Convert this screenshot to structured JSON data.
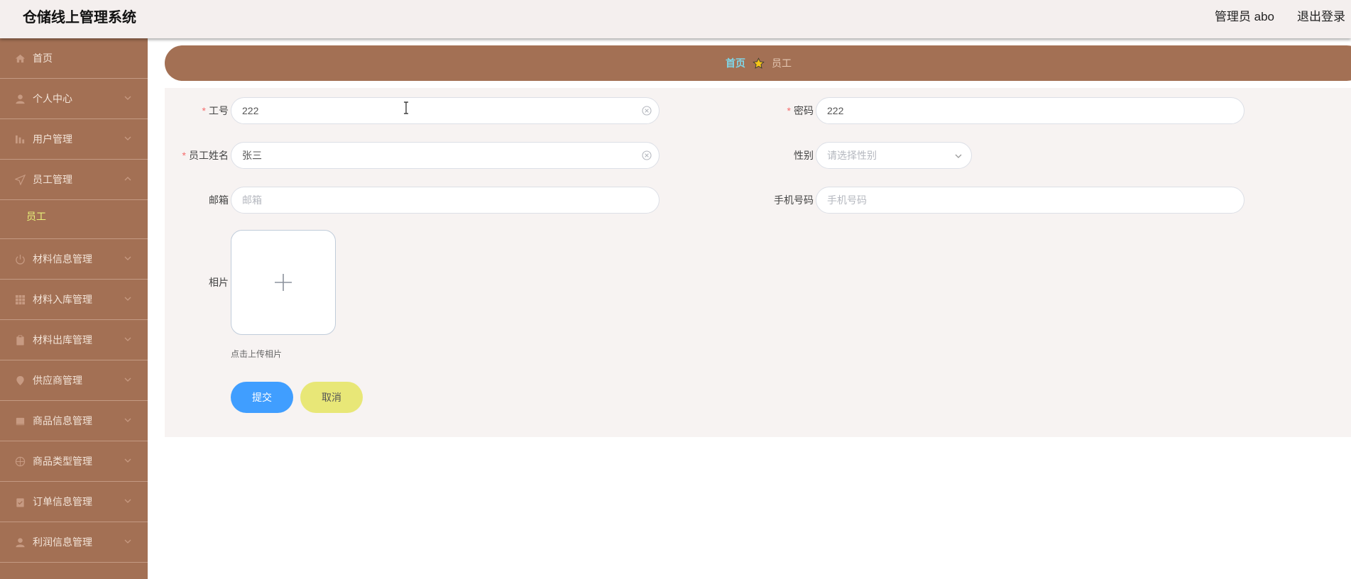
{
  "app": {
    "title": "仓储线上管理系统",
    "user": "管理员 abo",
    "logout": "退出登录"
  },
  "sidebar": {
    "items": [
      {
        "label": "首页",
        "icon": "home-icon",
        "has_arrow": false
      },
      {
        "label": "个人中心",
        "icon": "user-icon",
        "has_arrow": true
      },
      {
        "label": "用户管理",
        "icon": "chart-icon",
        "has_arrow": true
      },
      {
        "label": "员工管理",
        "icon": "paper-plane-icon",
        "has_arrow": true,
        "expanded": true
      },
      {
        "label": "材料信息管理",
        "icon": "power-icon",
        "has_arrow": true
      },
      {
        "label": "材料入库管理",
        "icon": "grid-icon",
        "has_arrow": true
      },
      {
        "label": "材料出库管理",
        "icon": "clipboard-icon",
        "has_arrow": true
      },
      {
        "label": "供应商管理",
        "icon": "location-icon",
        "has_arrow": true
      },
      {
        "label": "商品信息管理",
        "icon": "box-icon",
        "has_arrow": true
      },
      {
        "label": "商品类型管理",
        "icon": "basketball-icon",
        "has_arrow": true
      },
      {
        "label": "订单信息管理",
        "icon": "clipboard-check-icon",
        "has_arrow": true
      },
      {
        "label": "利润信息管理",
        "icon": "user-icon",
        "has_arrow": true
      }
    ],
    "subitem": {
      "label": "员工",
      "color": "#e8f27a"
    }
  },
  "breadcrumb": {
    "home": "首页",
    "current": "员工"
  },
  "form": {
    "employee_no": {
      "label": "工号",
      "value": "222",
      "required": true
    },
    "password": {
      "label": "密码",
      "value": "222",
      "required": true
    },
    "employee_name": {
      "label": "员工姓名",
      "value": "张三",
      "required": true
    },
    "gender": {
      "label": "性别",
      "placeholder": "请选择性别"
    },
    "email": {
      "label": "邮箱",
      "placeholder": "邮箱"
    },
    "phone": {
      "label": "手机号码",
      "placeholder": "手机号码"
    },
    "photo": {
      "label": "相片",
      "hint": "点击上传相片"
    },
    "submit": "提交",
    "cancel": "取消"
  },
  "colors": {
    "sidebar_bg": "#a37054",
    "header_bg": "#f4efee",
    "submit": "#409eff",
    "cancel": "#e8e777",
    "required": "#f56c6c"
  }
}
